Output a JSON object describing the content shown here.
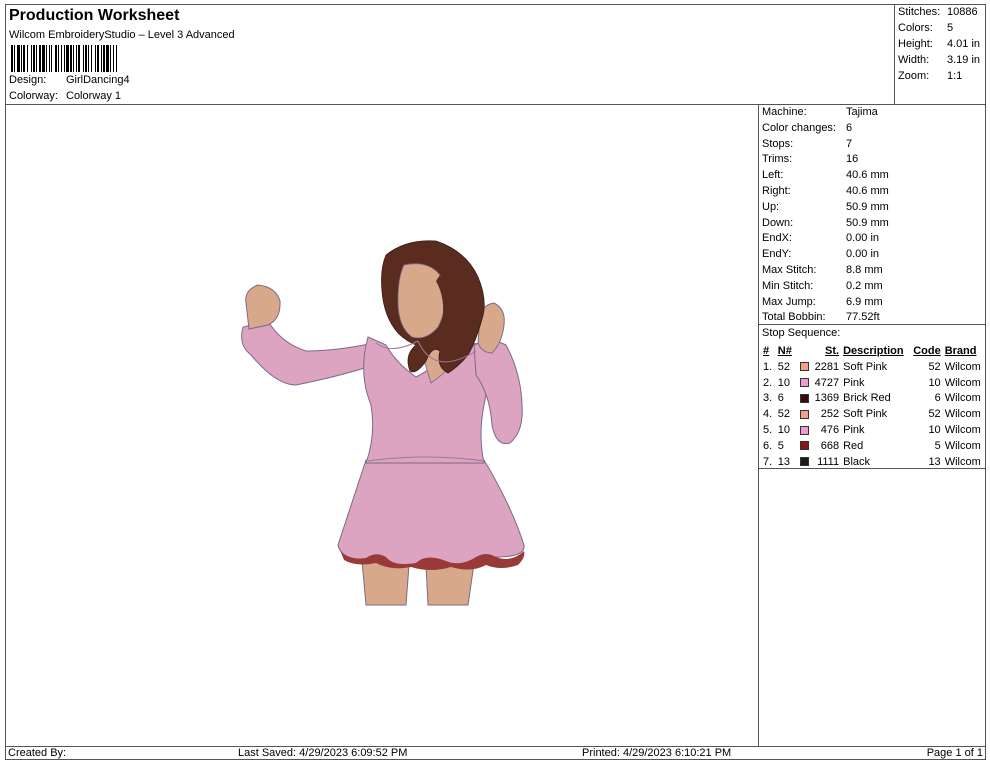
{
  "header": {
    "title": "Production Worksheet",
    "subtitle": "Wilcom EmbroideryStudio – Level 3 Advanced",
    "design_label": "Design:",
    "design_value": "GirlDancing4",
    "colorway_label": "Colorway:",
    "colorway_value": "Colorway 1"
  },
  "summary": {
    "stitches_label": "Stitches:",
    "stitches_value": "10886",
    "colors_label": "Colors:",
    "colors_value": "5",
    "height_label": "Height:",
    "height_value": "4.01 in",
    "width_label": "Width:",
    "width_value": "3.19 in",
    "zoom_label": "Zoom:",
    "zoom_value": "1:1"
  },
  "details": [
    {
      "k": "Machine:",
      "v": "Tajima"
    },
    {
      "k": "Color changes:",
      "v": "6"
    },
    {
      "k": "Stops:",
      "v": "7"
    },
    {
      "k": "Trims:",
      "v": "16"
    },
    {
      "k": "Left:",
      "v": "40.6 mm"
    },
    {
      "k": "Right:",
      "v": "40.6 mm"
    },
    {
      "k": "Up:",
      "v": "50.9 mm"
    },
    {
      "k": "Down:",
      "v": "50.9 mm"
    },
    {
      "k": "EndX:",
      "v": "0.00 in"
    },
    {
      "k": "EndY:",
      "v": "0.00 in"
    },
    {
      "k": "Max Stitch:",
      "v": "8.8 mm"
    },
    {
      "k": "Min Stitch:",
      "v": "0.2 mm"
    },
    {
      "k": "Max Jump:",
      "v": "6.9 mm"
    },
    {
      "k": "Total Bobbin:",
      "v": "77.52ft"
    }
  ],
  "stop_sequence": {
    "title": "Stop Sequence:",
    "headers": {
      "idx": "#",
      "n": "N#",
      "st": "St.",
      "desc": "Description",
      "code": "Code",
      "brand": "Brand"
    },
    "rows": [
      {
        "idx": "1.",
        "n": "52",
        "color": "#f2a08a",
        "st": "2281",
        "desc": "Soft Pink",
        "code": "52",
        "brand": "Wilcom"
      },
      {
        "idx": "2.",
        "n": "10",
        "color": "#f19ad0",
        "st": "4727",
        "desc": "Pink",
        "code": "10",
        "brand": "Wilcom"
      },
      {
        "idx": "3.",
        "n": "6",
        "color": "#3a0a10",
        "st": "1369",
        "desc": "Brick Red",
        "code": "6",
        "brand": "Wilcom"
      },
      {
        "idx": "4.",
        "n": "52",
        "color": "#f2a08a",
        "st": "252",
        "desc": "Soft Pink",
        "code": "52",
        "brand": "Wilcom"
      },
      {
        "idx": "5.",
        "n": "10",
        "color": "#f19ad0",
        "st": "476",
        "desc": "Pink",
        "code": "10",
        "brand": "Wilcom"
      },
      {
        "idx": "6.",
        "n": "5",
        "color": "#8b1414",
        "st": "668",
        "desc": "Red",
        "code": "5",
        "brand": "Wilcom"
      },
      {
        "idx": "7.",
        "n": "13",
        "color": "#1e1a18",
        "st": "1111",
        "desc": "Black",
        "code": "13",
        "brand": "Wilcom"
      }
    ]
  },
  "footer": {
    "created_by": "Created By:",
    "last_saved": "Last Saved: 4/29/2023 6:09:52 PM",
    "printed": "Printed: 4/29/2023 6:10:21 PM",
    "page": "Page 1 of 1"
  },
  "artwork": {
    "colors": {
      "dress": "#dca4c0",
      "dress_shade": "#c48aa6",
      "skin": "#d8a88a",
      "hair": "#5a2c20",
      "ruffle": "#9a3a38",
      "outline": "#7a6a8a"
    }
  }
}
